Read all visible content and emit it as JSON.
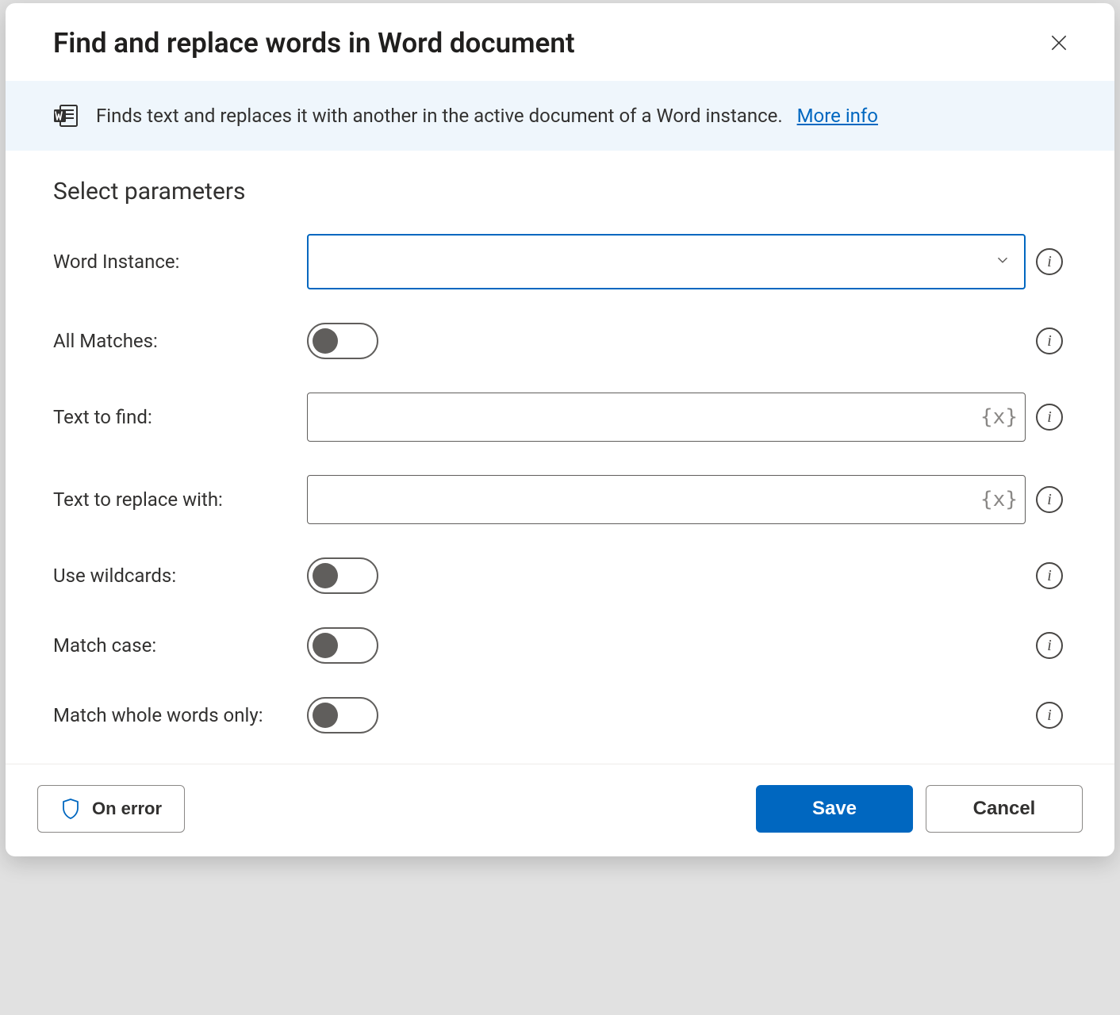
{
  "dialog": {
    "title": "Find and replace words in Word document"
  },
  "banner": {
    "description": "Finds text and replaces it with another in the active document of a Word instance.",
    "more_info": "More info"
  },
  "section": {
    "title": "Select parameters"
  },
  "fields": {
    "word_instance": {
      "label": "Word Instance:",
      "value": ""
    },
    "all_matches": {
      "label": "All Matches:",
      "value": false
    },
    "text_to_find": {
      "label": "Text to find:",
      "value": ""
    },
    "text_replace": {
      "label": "Text to replace with:",
      "value": ""
    },
    "use_wildcards": {
      "label": "Use wildcards:",
      "value": false
    },
    "match_case": {
      "label": "Match case:",
      "value": false
    },
    "whole_words": {
      "label": "Match whole words only:",
      "value": false
    }
  },
  "footer": {
    "on_error": "On error",
    "save": "Save",
    "cancel": "Cancel"
  },
  "icons": {
    "variable": "{x}",
    "info": "i"
  }
}
